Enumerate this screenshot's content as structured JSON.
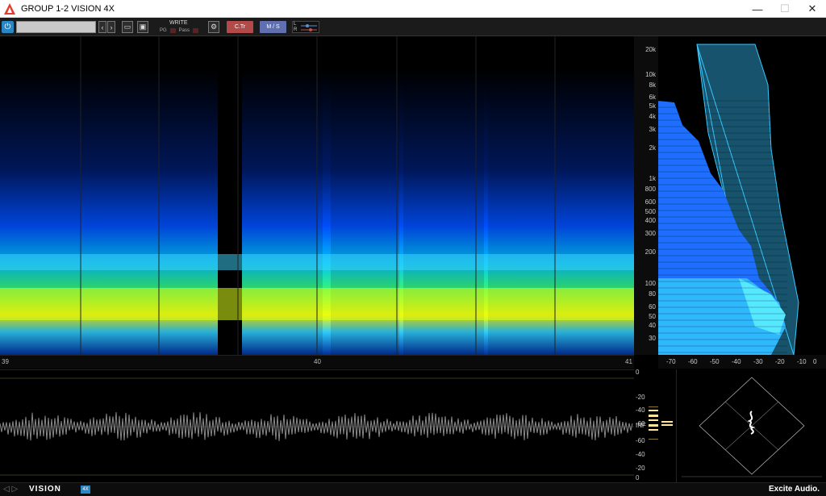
{
  "window": {
    "title": "GROUP 1-2 VISION 4X",
    "controls": {
      "minimize": "—",
      "maximize": "☐",
      "close": "✕"
    }
  },
  "toolbar": {
    "preset_value": "",
    "write_label": "WRITE",
    "pg_label": "PG",
    "pass_label": "Pass",
    "ctr_label": "C.Tr",
    "ms_label": "M / S",
    "lr_left": "L",
    "lr_right": "R"
  },
  "timeline": {
    "marks": [
      "39",
      "40",
      "41"
    ]
  },
  "freq_axis": {
    "labels": [
      "20k",
      "10k",
      "8k",
      "6k",
      "5k",
      "4k",
      "3k",
      "2k",
      "1k",
      "800",
      "600",
      "500",
      "400",
      "300",
      "200",
      "100",
      "80",
      "60",
      "50",
      "40",
      "30"
    ]
  },
  "db_axis": {
    "labels": [
      "-70",
      "-60",
      "-50",
      "-40",
      "-30",
      "-20",
      "-10",
      "0"
    ]
  },
  "meter_scale": {
    "labels": [
      "0",
      "-20",
      "-40",
      "-60",
      "INF",
      "-60",
      "-40",
      "-20",
      "0"
    ]
  },
  "footer": {
    "logo": "VISION",
    "version": "4X",
    "brand": "Excite Audio."
  },
  "colors": {
    "accent": "#2a87c6",
    "ctr": "#b34a4a",
    "ms": "#5f6fb0"
  }
}
